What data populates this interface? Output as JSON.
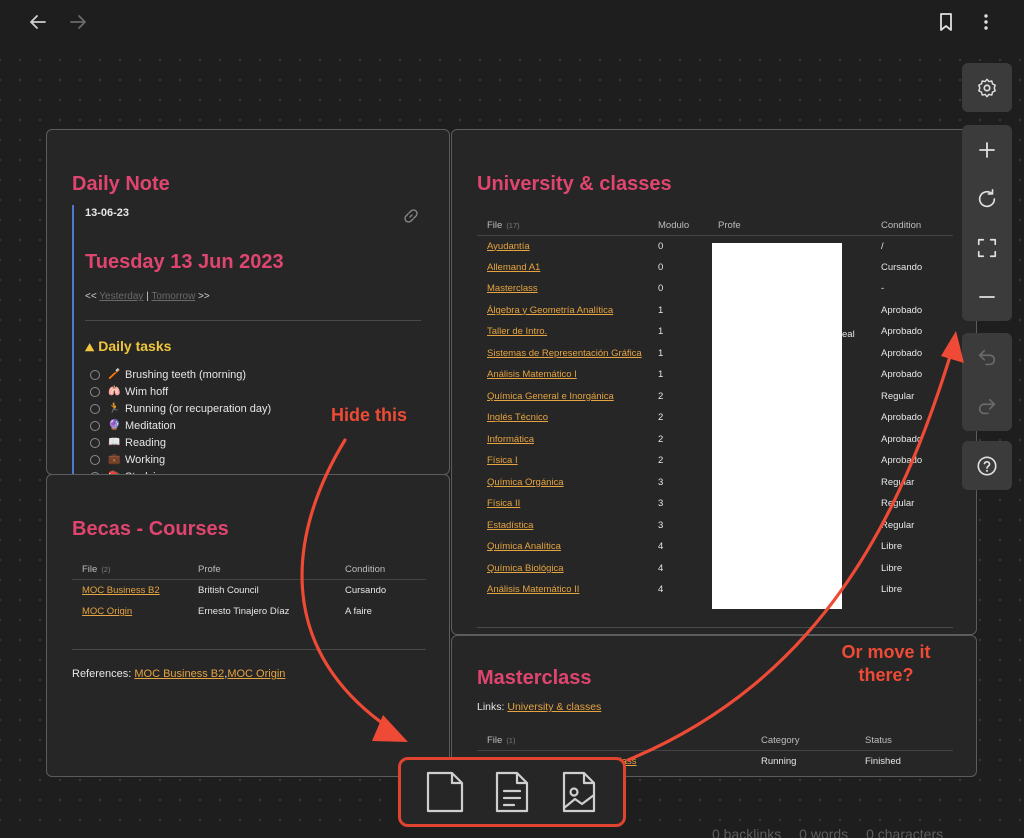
{
  "colors": {
    "accent_title": "#e0456f",
    "link": "#e5a441",
    "annotation": "#ee4a35",
    "task_heading": "#f0c63c"
  },
  "daily_note": {
    "title": "Daily Note",
    "date_code": "13-06-23",
    "heading": "Tuesday 13 Jun 2023",
    "nav_prefix": "<<",
    "yesterday": "Yesterday",
    "separator": "|",
    "tomorrow": "Tomorrow",
    "nav_suffix": ">>",
    "tasks_title": "Daily tasks",
    "tasks": [
      {
        "emoji": "🪥",
        "label": "Brushing teeth (morning)"
      },
      {
        "emoji": "🫁",
        "label": "Wim hoff"
      },
      {
        "emoji": "🏃",
        "label": "Running (or recuperation day)"
      },
      {
        "emoji": "🔮",
        "label": "Meditation"
      },
      {
        "emoji": "📖",
        "label": "Reading"
      },
      {
        "emoji": "💼",
        "label": "Working"
      },
      {
        "emoji": "📚",
        "label": "Studying"
      }
    ]
  },
  "becas": {
    "title": "Becas - Courses",
    "headers": {
      "file": "File",
      "count": "(2)",
      "profe": "Profe",
      "condition": "Condition"
    },
    "rows": [
      {
        "file": "MOC Business B2",
        "profe": "British Council",
        "condition": "Cursando"
      },
      {
        "file": "MOC Origin",
        "profe": "Ernesto Tinajero Díaz",
        "condition": "A faire"
      }
    ],
    "references_label": "References:",
    "ref1": "MOC Business B2",
    "ref_sep": ",",
    "ref2": "MOC Origin"
  },
  "university": {
    "title": "University & classes",
    "headers": {
      "file": "File",
      "count": "(17)",
      "modulo": "Modulo",
      "profe": "Profe",
      "condition": "Condition"
    },
    "partial_text": "eal",
    "rows": [
      {
        "file": "Ayudantía",
        "modulo": "0",
        "condition": "/"
      },
      {
        "file": "Allemand A1",
        "modulo": "0",
        "condition": "Cursando"
      },
      {
        "file": "Masterclass",
        "modulo": "0",
        "condition": "-"
      },
      {
        "file": "Álgebra y Geometría Analítica",
        "modulo": "1",
        "condition": "Aprobado"
      },
      {
        "file": "Taller de Intro.",
        "modulo": "1",
        "condition": "Aprobado"
      },
      {
        "file": "Sistemas de Representación Gráfica",
        "modulo": "1",
        "condition": "Aprobado"
      },
      {
        "file": "Análisis Matemático I",
        "modulo": "1",
        "condition": "Aprobado"
      },
      {
        "file": "Química General e Inorgánica",
        "modulo": "2",
        "condition": "Regular"
      },
      {
        "file": "Inglés Técnico",
        "modulo": "2",
        "condition": "Aprobado"
      },
      {
        "file": "Informática",
        "modulo": "2",
        "condition": "Aprobado"
      },
      {
        "file": "Física I",
        "modulo": "2",
        "condition": "Aprobado"
      },
      {
        "file": "Química Orgánica",
        "modulo": "3",
        "condition": "Regular"
      },
      {
        "file": "Física II",
        "modulo": "3",
        "condition": "Regular"
      },
      {
        "file": "Estadística",
        "modulo": "3",
        "condition": "Regular"
      },
      {
        "file": "Química Analítica",
        "modulo": "4",
        "condition": "Libre"
      },
      {
        "file": "Química Biológica",
        "modulo": "4",
        "condition": "Libre"
      },
      {
        "file": "Análisis Matemático II",
        "modulo": "4",
        "condition": "Libre"
      }
    ]
  },
  "masterclass": {
    "title": "Masterclass",
    "links_label": "Links:",
    "link": "University & classes",
    "headers": {
      "file": "File",
      "count": "(1)",
      "category": "Category",
      "status": "Status"
    },
    "row": {
      "file": "...class",
      "category": "Running",
      "status": "Finished"
    }
  },
  "annotations": {
    "hide": "Hide this",
    "move_line1": "Or move it",
    "move_line2": "there?"
  },
  "status_bar": {
    "backlinks": "0 backlinks",
    "words": "0 words",
    "characters": "0 characters"
  },
  "icons": [
    "arrow-left-icon",
    "arrow-right-icon",
    "bookmark-icon",
    "more-vertical-icon",
    "gear-icon",
    "plus-icon",
    "reset-icon",
    "fullscreen-icon",
    "minus-icon",
    "undo-icon",
    "redo-icon",
    "help-icon",
    "link-icon",
    "new-card-icon",
    "new-note-card-icon",
    "new-media-card-icon"
  ]
}
